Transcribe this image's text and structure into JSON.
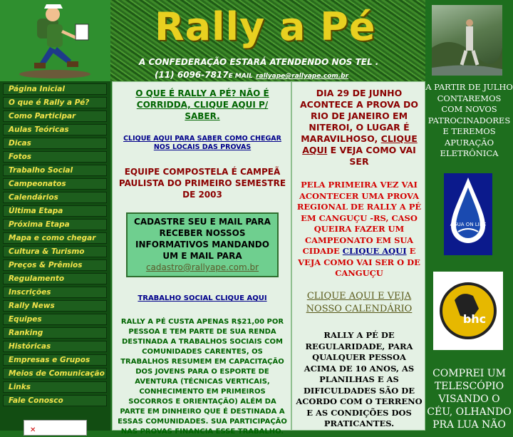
{
  "header": {
    "title": "Rally a Pé",
    "notice_line1": "A CONFEDERAÇÃO ESTARÁ ATENDENDO NOS TEL .",
    "phone": "(11) 6096-7817",
    "email_label": "E MAIL",
    "email": "rallyape@rallyape.com.br"
  },
  "nav": {
    "items": [
      "Página Inicial",
      "O que é Rally a Pé?",
      "Como Participar",
      "Aulas Teóricas",
      "Dicas",
      "Fotos",
      "Trabalho Social",
      "Campeonatos",
      "Calendários",
      "Última Etapa",
      "Próxima Etapa",
      "Mapa e como chegar",
      "Cultura & Turismo",
      "Preços & Prêmios",
      "Regulamento",
      "Inscrições",
      "Rally News",
      "Equipes",
      "Ranking",
      "Históricas",
      "Empresas e Grupos",
      "Meios de Comunicação",
      "Links",
      "Fale Conosco"
    ]
  },
  "middle": {
    "question_text": "O QUE É RALLY A PÉ? NÃO É CORRIDDA, CLIQUE AQUI P/ SABER.",
    "directions_link": "CLIQUE AQUI PARA SABER COMO CHEGAR NOS LOCAIS DAS PROVAS",
    "team_news": "EQUIPE COMPOSTELA É CAMPEÃ PAULISTA DO PRIMEIRO SEMESTRE DE 2003",
    "signup_text": "CADASTRE SEU E MAIL PARA RECEBER NOSSOS INFORMATIVOS MANDANDO UM E MAIL PARA",
    "signup_email": "cadastro@rallyape.com.br",
    "social_link": "TRABALHO SOCIAL CLIQUE AQUI",
    "price_text": "RALLY A PÉ CUSTA APENAS R$21,00 POR PESSOA E TEM PARTE DE SUA RENDA DESTINADA A TRABALHOS SOCIAIS COM COMUNIDADES CARENTES, OS TRABALHOS RESUMEM EM CAPACITAÇÃO DOS JOVENS PARA O ESPORTE DE AVENTURA (TÉCNICAS VERTICAIS, CONHECIMENTO EM PRIMEIROS SOCORROS E ORIENTAÇÃO) ALÉM DA PARTE EM DINHEIRO QUE É DESTINADA A ESSAS COMUNIDADES. SUA PARTICIPAÇÃO NAS PROVAS FINANCIA ESSE TRABALHO."
  },
  "right": {
    "date_pre": "DIA 29 DE JUNHO ACONTECE A PROVA DO RIO DE JANEIRO EM NITEROI, O LUGAR É MARAVILHOSO,",
    "date_link": "CLIQUE AQUI",
    "date_post": "E VEJA COMO VAI SER",
    "first_pre": "PELA PRIMEIRA VEZ VAI ACONTECER UMA PROVA REGIONAL DE RALLY A PÉ EM CANGUÇU -RS, CASO QUEIRA FAZER UM CAMPEONATO EM SUA CIDADE",
    "first_link": "CLIQUE AQUI",
    "first_post": "E VEJA COMO VAI SER O DE CANGUÇU",
    "calendar_link": "CLIQUE AQUI E VEJA NOSSO CALENDÁRIO",
    "regularity": "RALLY A PÉ DE REGULARIDADE, PARA QUALQUER PESSOA ACIMA DE 10 ANOS, AS PLANILHAS E AS DIFICULDADES SÃO DE ACORDO COM O TERRENO E AS CONDIÇÕES DOS PRATICANTES."
  },
  "side": {
    "julho": "A PARTIR DE JULHO CONTAREMOS COM NOVOS PATROCINADORES E TEREMOS APURAÇÃO ELETRÔNICA",
    "agua_logo_text": "ÁGUA ON LINE",
    "bhc_logo_text": "bhc",
    "telescope": "COMPREI UM TELESCÓPIO VISANDO O CÉU, OLHANDO PRA LUA NÃO"
  },
  "colors": {
    "nav_text": "#f2e34a",
    "title": "#e8d020",
    "content_bg": "#e4f1e4",
    "page_bg": "#1e6e1e"
  }
}
